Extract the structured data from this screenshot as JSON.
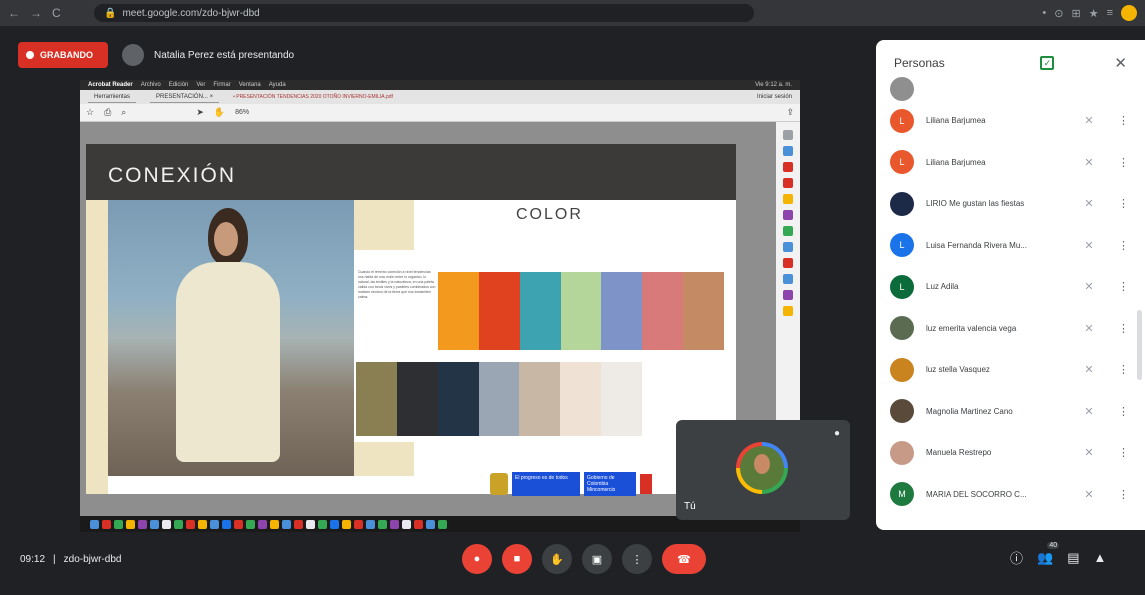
{
  "browser": {
    "url": "meet.google.com/zdo-bjwr-dbd",
    "nav_icons": [
      "←",
      "→",
      "C"
    ],
    "ext_icons": [
      "•",
      "⊙",
      "⊞",
      "★",
      "≡"
    ]
  },
  "meet": {
    "recording_label": "GRABANDO",
    "presenting_text": "Natalia Perez está presentando",
    "self_label": "Tú",
    "time": "09:12",
    "separator": "|",
    "meeting_code": "zdo-bjwr-dbd",
    "people_count": "40"
  },
  "shared_screen": {
    "menubar_app": "Acrobat Reader",
    "menubar_items": [
      "Archivo",
      "Edición",
      "Ver",
      "Firmar",
      "Ventana",
      "Ayuda"
    ],
    "menubar_right": "Vie 9:12 a. m.",
    "file_title": "• PRESENTACIÓN TENDENCIAS 2020 OTOÑO INVIERNO-EMILIA.pdf",
    "tabs": [
      "Herramientas",
      "PRESENTACIÓN... ×"
    ],
    "tab_right": "Iniciar sesión",
    "zoom": "86%",
    "slide_header": "CONEXIÓN",
    "color_title": "COLOR",
    "description": "Cuando el término conexión a nivel tendencias nos habla de una unión entre lo orgánico, lo natural, las textiles y la naturaleza, en una paleta cálida con tonos vivos y pasteles combinados con matices neutros de la tierra que nos transmiten calma.",
    "logo_text_1": "El progreso es de todos",
    "logo_text_2": "Gobierno de Colombia Mincomercio"
  },
  "palette_top": [
    "#f39a1e",
    "#e0411f",
    "#3ea3b0",
    "#b4d69a",
    "#7e94c8",
    "#d97a7a",
    "#c38a63"
  ],
  "palette_bottom": [
    "#8a7f52",
    "#2d2f33",
    "#223446",
    "#9aa6b3",
    "#c8b7a5",
    "#efe2d4",
    "#eeebe6"
  ],
  "people": {
    "title": "Personas",
    "participants": [
      {
        "name": "Liliana Barjumea",
        "initial": "L",
        "color": "#e8582c"
      },
      {
        "name": "Liliana Barjumea",
        "initial": "L",
        "color": "#e8582c"
      },
      {
        "name": "LIRIO Me gustan las fiestas",
        "initial": "",
        "color": "#1c2a48"
      },
      {
        "name": "Luisa Fernanda Rivera Mu...",
        "initial": "L",
        "color": "#1a73e8"
      },
      {
        "name": "Luz Adila",
        "initial": "L",
        "color": "#0b6b3a"
      },
      {
        "name": "luz emerita valencia vega",
        "initial": "",
        "color": "#5b6b52"
      },
      {
        "name": "luz stella Vasquez",
        "initial": "",
        "color": "#c9831f"
      },
      {
        "name": "Magnolia Martinez Cano",
        "initial": "",
        "color": "#5a4a3a"
      },
      {
        "name": "Manuela Restrepo",
        "initial": "",
        "color": "#c79a88"
      },
      {
        "name": "MARIA DEL SOCORRO C...",
        "initial": "M",
        "color": "#1e7a3f"
      }
    ]
  },
  "icons": {
    "close": "✕",
    "check": "✓",
    "mic_off": "✕",
    "more": "⋮",
    "mic": "●",
    "cam_off": "■",
    "hand": "✋",
    "present": "▣",
    "end_call": "☎",
    "info": "ⓘ",
    "people": "👥",
    "chat": "▤",
    "activities": "▲"
  }
}
